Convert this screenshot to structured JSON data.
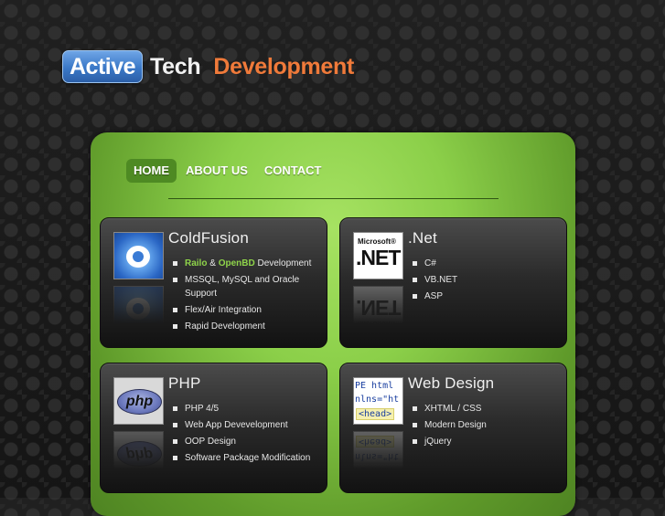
{
  "logo": {
    "part1": "Active",
    "part2": "Tech",
    "part3": "Development"
  },
  "nav": {
    "items": [
      "HOME",
      "ABOUT US",
      "CONTACT"
    ],
    "active": "HOME"
  },
  "cards": [
    {
      "title": "ColdFusion",
      "icon": "coldfusion-logo-icon",
      "items": [
        {
          "parts": [
            "Railo",
            " & ",
            "OpenBD",
            " Development"
          ]
        },
        {
          "text": "MSSQL, MySQL and Oracle Support"
        },
        {
          "text": "Flex/Air Integration"
        },
        {
          "text": "Rapid Development"
        }
      ]
    },
    {
      "title": ".Net",
      "icon": "microsoft-net-logo-icon",
      "icon_text": {
        "brand": "Microsoft®",
        "name": ".NET"
      },
      "items": [
        {
          "text": "C#"
        },
        {
          "text": "VB.NET"
        },
        {
          "text": "ASP"
        }
      ]
    },
    {
      "title": "PHP",
      "icon": "php-logo-icon",
      "icon_text": {
        "name": "php"
      },
      "items": [
        {
          "text": "PHP 4/5"
        },
        {
          "text": "Web App Devevelopment"
        },
        {
          "text": "OOP Design"
        },
        {
          "text": "Software Package Modification"
        }
      ]
    },
    {
      "title": "Web Design",
      "icon": "html-code-icon",
      "icon_text": {
        "line1": "PE html",
        "line2": "nlns=\"ht",
        "line3": "<head>"
      },
      "items": [
        {
          "text": "XHTML / CSS"
        },
        {
          "text": "Modern Design"
        },
        {
          "text": "jQuery"
        }
      ]
    }
  ],
  "colors": {
    "accent_green": "#8fd44a",
    "logo_blue": "#3a78c7",
    "logo_orange": "#f07a3a"
  }
}
